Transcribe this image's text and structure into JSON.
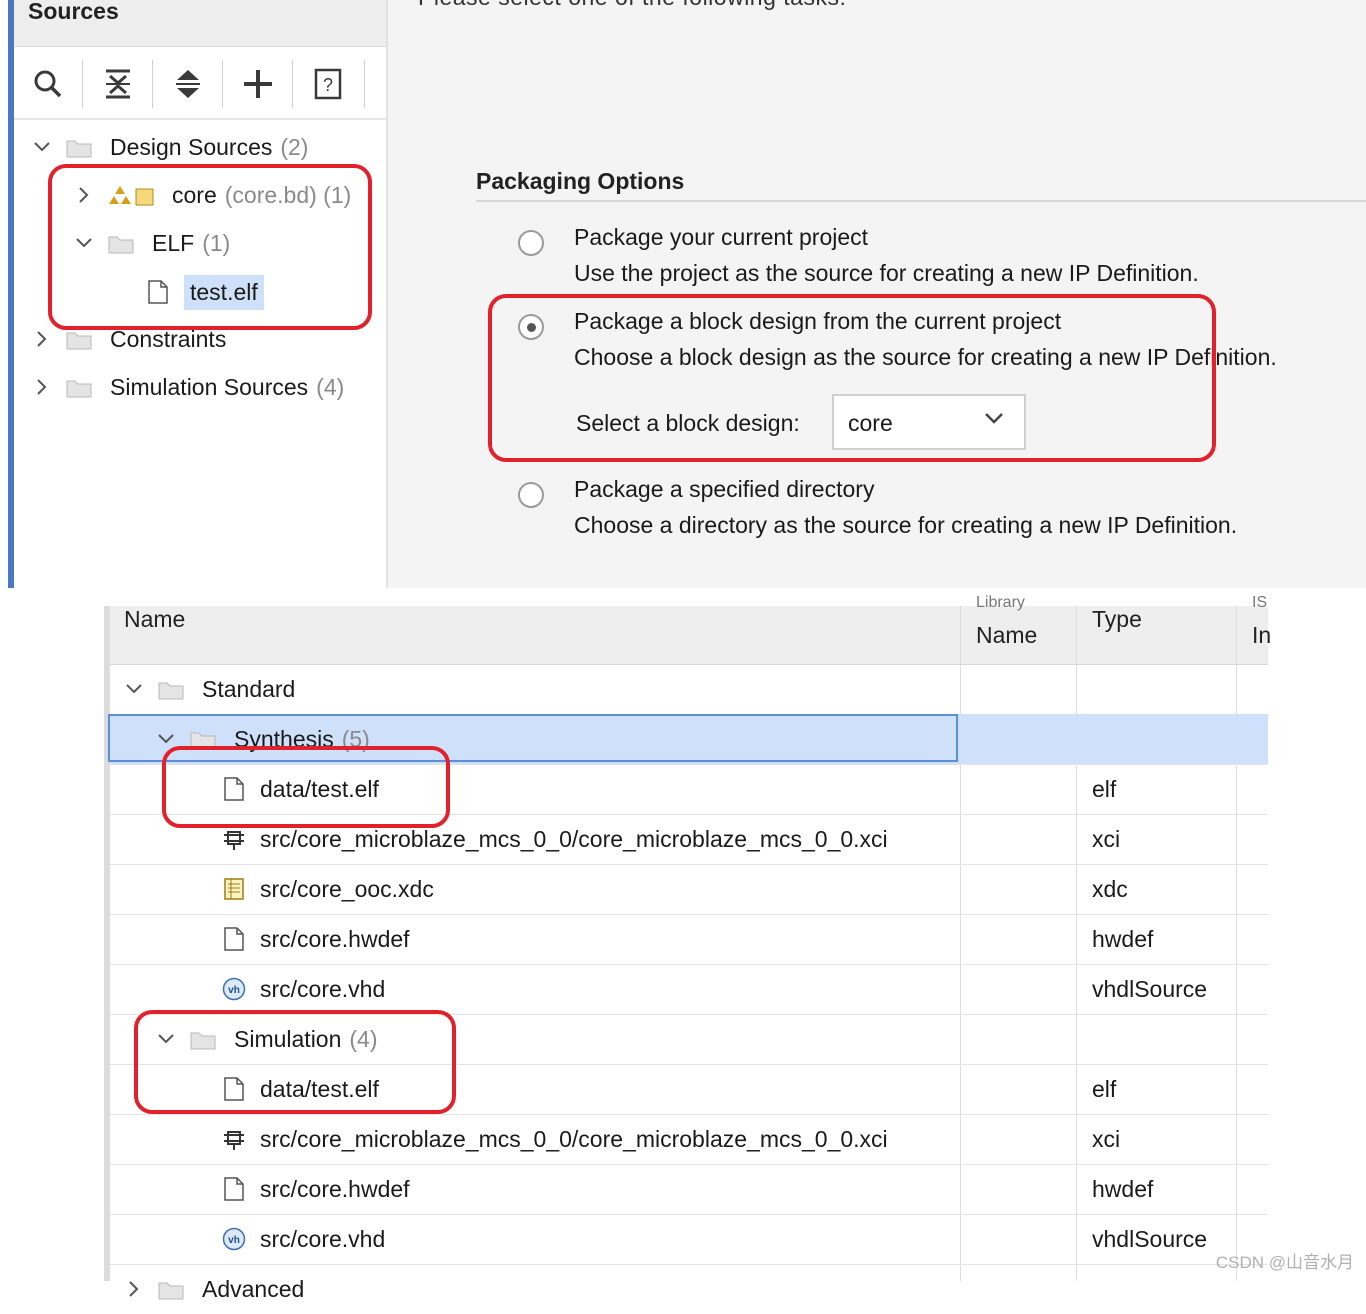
{
  "sources_panel": {
    "title": "Sources",
    "toolbar": [
      {
        "name": "search-icon"
      },
      {
        "name": "collapse-all-icon"
      },
      {
        "name": "expand-all-icon"
      },
      {
        "name": "add-icon"
      },
      {
        "name": "help-icon"
      }
    ],
    "tree": {
      "design_sources": {
        "label": "Design Sources",
        "count": "(2)"
      },
      "core": {
        "label": "core",
        "detail": "(core.bd) (1)"
      },
      "elf": {
        "label": "ELF",
        "count": "(1)"
      },
      "test_elf": {
        "label": "test.elf"
      },
      "constraints": {
        "label": "Constraints"
      },
      "simulation_sources": {
        "label": "Simulation Sources",
        "count": "(4)"
      }
    }
  },
  "packaging": {
    "cut_heading": "Please select one of the following tasks:",
    "section_title": "Packaging Options",
    "options": [
      {
        "title": "Package your current project",
        "desc": "Use the project as the source for creating a new IP Definition."
      },
      {
        "title": "Package a block design from the current project",
        "desc": "Choose a block design as the source for creating a new IP Definition."
      },
      {
        "title": "Package a specified directory",
        "desc": "Choose a directory as the source for creating a new IP Definition."
      }
    ],
    "selected_option": "Package a block design from the current project",
    "select_label": "Select a block design:",
    "select_value": "core"
  },
  "file_table": {
    "headers": {
      "name": "Name",
      "library_top": "Library",
      "library_name": "Name",
      "type": "Type",
      "cut_top": "IS",
      "cut": "In"
    },
    "groups": {
      "standard": {
        "label": "Standard"
      },
      "synthesis": {
        "label": "Synthesis",
        "count": "(5)"
      },
      "simulation": {
        "label": "Simulation",
        "count": "(4)"
      },
      "advanced": {
        "label": "Advanced"
      }
    },
    "synthesis_files": [
      {
        "name": "data/test.elf",
        "type": "elf",
        "icon": "file-icon"
      },
      {
        "name": "src/core_microblaze_mcs_0_0/core_microblaze_mcs_0_0.xci",
        "type": "xci",
        "icon": "ip-chip-icon"
      },
      {
        "name": "src/core_ooc.xdc",
        "type": "xdc",
        "icon": "constraints-file-icon"
      },
      {
        "name": "src/core.hwdef",
        "type": "hwdef",
        "icon": "file-icon"
      },
      {
        "name": "src/core.vhd",
        "type": "vhdlSource",
        "icon": "vhdl-icon"
      }
    ],
    "simulation_files": [
      {
        "name": "data/test.elf",
        "type": "elf",
        "icon": "file-icon"
      },
      {
        "name": "src/core_microblaze_mcs_0_0/core_microblaze_mcs_0_0.xci",
        "type": "xci",
        "icon": "ip-chip-icon"
      },
      {
        "name": "src/core.hwdef",
        "type": "hwdef",
        "icon": "file-icon"
      },
      {
        "name": "src/core.vhd",
        "type": "vhdlSource",
        "icon": "vhdl-icon"
      }
    ]
  },
  "watermark": "CSDN @山音水月",
  "colors": {
    "highlight_red": "#e1222c",
    "selection_blue": "#cfe0fb",
    "accent_blue": "#4a78c2"
  }
}
